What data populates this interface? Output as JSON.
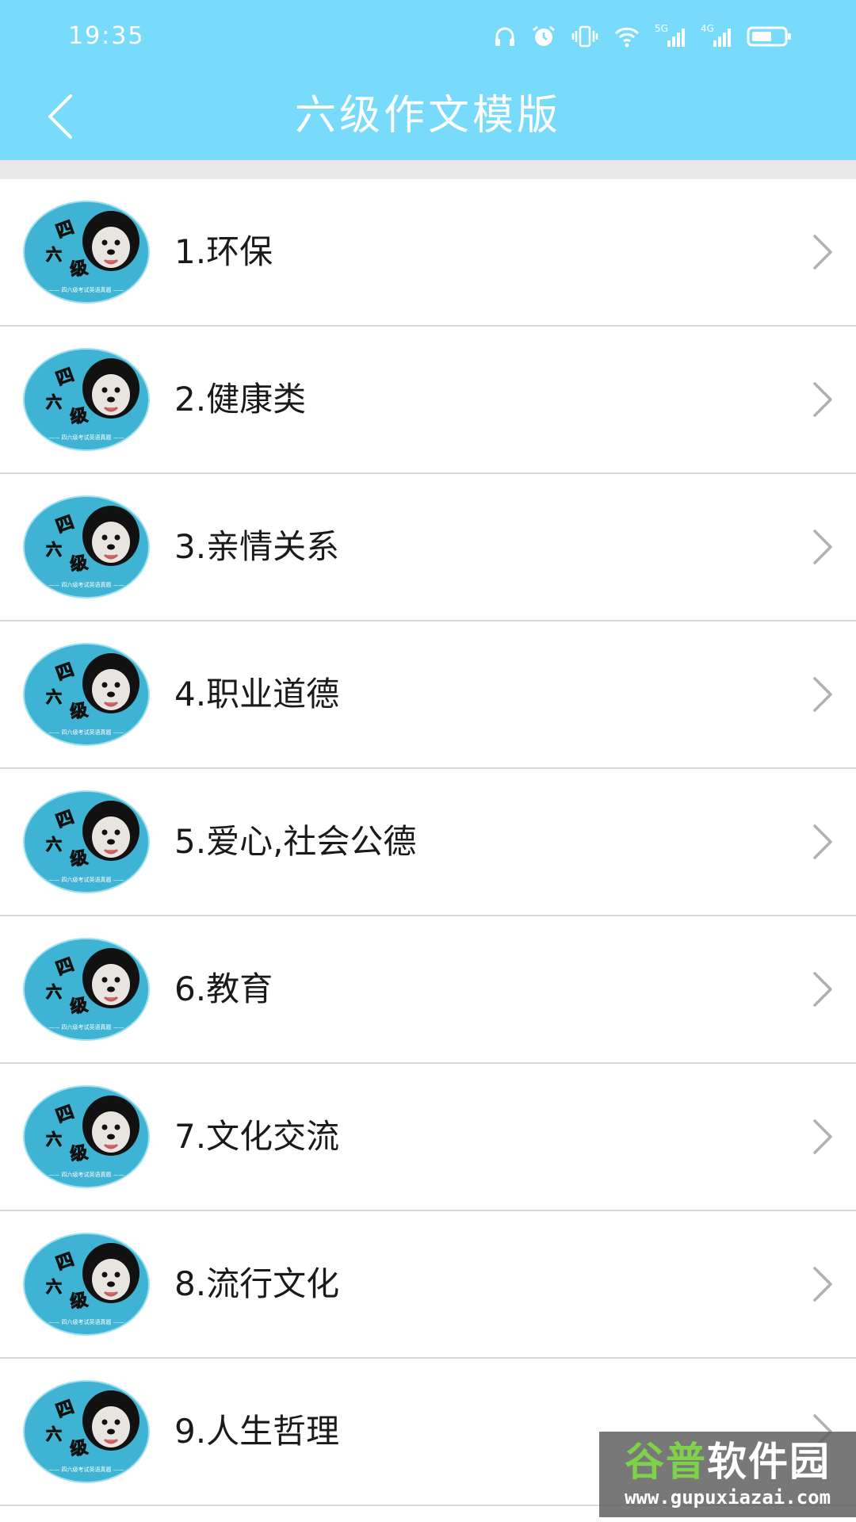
{
  "status_bar": {
    "time": "19:35",
    "icons": [
      "headphones-icon",
      "alarm-icon",
      "vibrate-icon",
      "wifi-icon",
      "signal-5g-icon",
      "signal-4g-icon",
      "battery-icon"
    ],
    "sim1_label": "5G",
    "sim2_label": "4G"
  },
  "header": {
    "title": "六级作文模版",
    "back_icon": "chevron-left-icon"
  },
  "colors": {
    "header_bg": "#79dbfb",
    "thumbnail_bg": "#3fb3d3"
  },
  "list": {
    "items": [
      {
        "label": "1.环保"
      },
      {
        "label": "2.健康类"
      },
      {
        "label": "3.亲情关系"
      },
      {
        "label": "4.职业道德"
      },
      {
        "label": "5.爱心,社会公德"
      },
      {
        "label": "6.教育"
      },
      {
        "label": "7.文化交流"
      },
      {
        "label": "8.流行文化"
      },
      {
        "label": "9.人生哲理"
      }
    ],
    "thumbnail_text": [
      "四",
      "六",
      "级"
    ],
    "thumbnail_caption": "—— 四六级考试英语真题 ——"
  },
  "watermark": {
    "brand_part1": "谷普",
    "brand_part2": "软件园",
    "url": "www.gupuxiazai.com"
  }
}
